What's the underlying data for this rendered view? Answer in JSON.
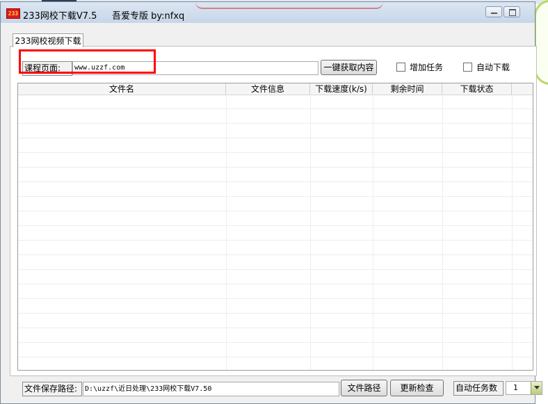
{
  "window": {
    "app_icon_text": "233",
    "title": "233网校下载V7.5",
    "subtitle": "吾爱专版  by:nfxq"
  },
  "tabs": [
    {
      "label": "233网校视频下载"
    }
  ],
  "course": {
    "label": "课程页面:",
    "url_value": "www.uzzf.com"
  },
  "toolbar": {
    "fetch_button": "一键获取内容",
    "add_task_label": "增加任务",
    "auto_download_label": "自动下载"
  },
  "table": {
    "columns": [
      "文件名",
      "文件信息",
      "下载速度(k/s)",
      "剩余时间",
      "下载状态"
    ],
    "rows": []
  },
  "footer": {
    "save_path_label": "文件保存路径:",
    "save_path_value": "D:\\uzzf\\近日处理\\233网校下载V7.50",
    "browse_button": "文件路径",
    "update_button": "更新检查",
    "auto_tasks_label": "自动任务数",
    "auto_tasks_value": "1"
  }
}
